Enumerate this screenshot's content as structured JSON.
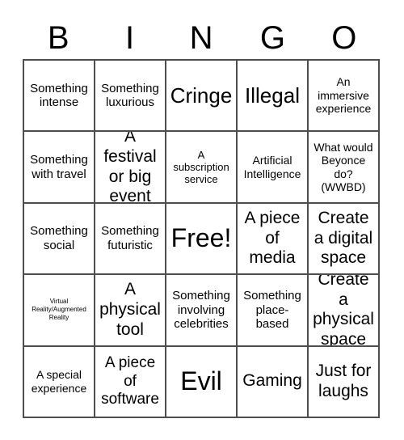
{
  "header": {
    "letters": [
      "B",
      "I",
      "N",
      "G",
      "O"
    ]
  },
  "grid": {
    "columns": 5,
    "rows": 5,
    "border_color": "#4d4d4d",
    "background_color": "#ffffff",
    "text_color": "#000000",
    "cells": [
      {
        "text": "Something intense",
        "size": "fs-md"
      },
      {
        "text": "Something luxurious",
        "size": "fs-md"
      },
      {
        "text": "Cringe",
        "size": "fs-xxl"
      },
      {
        "text": "Illegal",
        "size": "fs-xxl"
      },
      {
        "text": "An immersive experience",
        "size": "fs-sm"
      },
      {
        "text": "Something with travel",
        "size": "fs-md"
      },
      {
        "text": "A festival or big event",
        "size": "fs-xl"
      },
      {
        "text": "A subscription service",
        "size": "fs-xs"
      },
      {
        "text": "Artificial Intelligence",
        "size": "fs-sm"
      },
      {
        "text": "What would Beyonce do? (WWBD)",
        "size": "fs-sm"
      },
      {
        "text": "Something social",
        "size": "fs-md"
      },
      {
        "text": "Something futuristic",
        "size": "fs-md"
      },
      {
        "text": "Free!",
        "size": "fs-huge"
      },
      {
        "text": "A piece of media",
        "size": "fs-xl"
      },
      {
        "text": "Create a digital space",
        "size": "fs-xl"
      },
      {
        "text": "Virtual Reality/Augmented Reality",
        "size": "fs-xxs"
      },
      {
        "text": "A physical tool",
        "size": "fs-xl"
      },
      {
        "text": "Something involving celebrities",
        "size": "fs-md"
      },
      {
        "text": "Something place-based",
        "size": "fs-md"
      },
      {
        "text": "Create a physical space",
        "size": "fs-xl"
      },
      {
        "text": "A special experience",
        "size": "fs-sm"
      },
      {
        "text": "A piece of software",
        "size": "fs-lg"
      },
      {
        "text": "Evil",
        "size": "fs-huge"
      },
      {
        "text": "Gaming",
        "size": "fs-xl"
      },
      {
        "text": "Just for laughs",
        "size": "fs-xl"
      }
    ]
  }
}
